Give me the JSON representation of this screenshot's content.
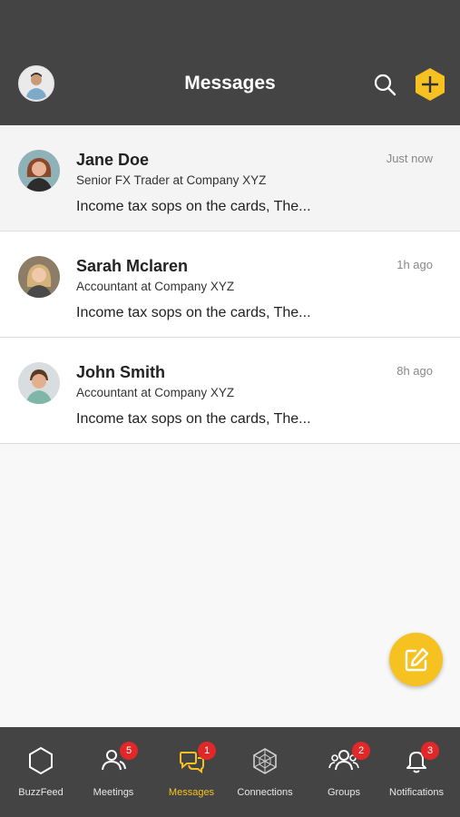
{
  "header": {
    "title": "Messages",
    "user_avatar": "user-avatar",
    "search_icon": "search-icon",
    "add_icon": "hexagon-plus-icon"
  },
  "conversations": [
    {
      "name": "Jane Doe",
      "role": "Senior FX Trader at Company XYZ",
      "preview": "Income tax sops on the cards, The...",
      "time": "Just now",
      "active": true
    },
    {
      "name": "Sarah Mclaren",
      "role": "Accountant at Company XYZ",
      "preview": "Income tax sops on the cards, The...",
      "time": "1h ago",
      "active": false
    },
    {
      "name": "John Smith",
      "role": "Accountant at Company XYZ",
      "preview": "Income tax sops on the cards, The...",
      "time": "8h ago",
      "active": false
    }
  ],
  "compose": {
    "icon": "compose-icon"
  },
  "tabs": [
    {
      "label": "BuzzFeed",
      "icon": "hexagon-icon",
      "badge": ""
    },
    {
      "label": "Meetings",
      "icon": "people-icon",
      "badge": "5"
    },
    {
      "label": "Messages",
      "icon": "chat-icon",
      "badge": "1",
      "active": true
    },
    {
      "label": "Connections",
      "icon": "network-icon",
      "badge": ""
    },
    {
      "label": "Groups",
      "icon": "group-icon",
      "badge": "2"
    },
    {
      "label": "Notifications",
      "icon": "bell-icon",
      "badge": "3"
    }
  ],
  "colors": {
    "header_bg": "#444444",
    "accent": "#f6c221",
    "badge": "#e02828"
  }
}
